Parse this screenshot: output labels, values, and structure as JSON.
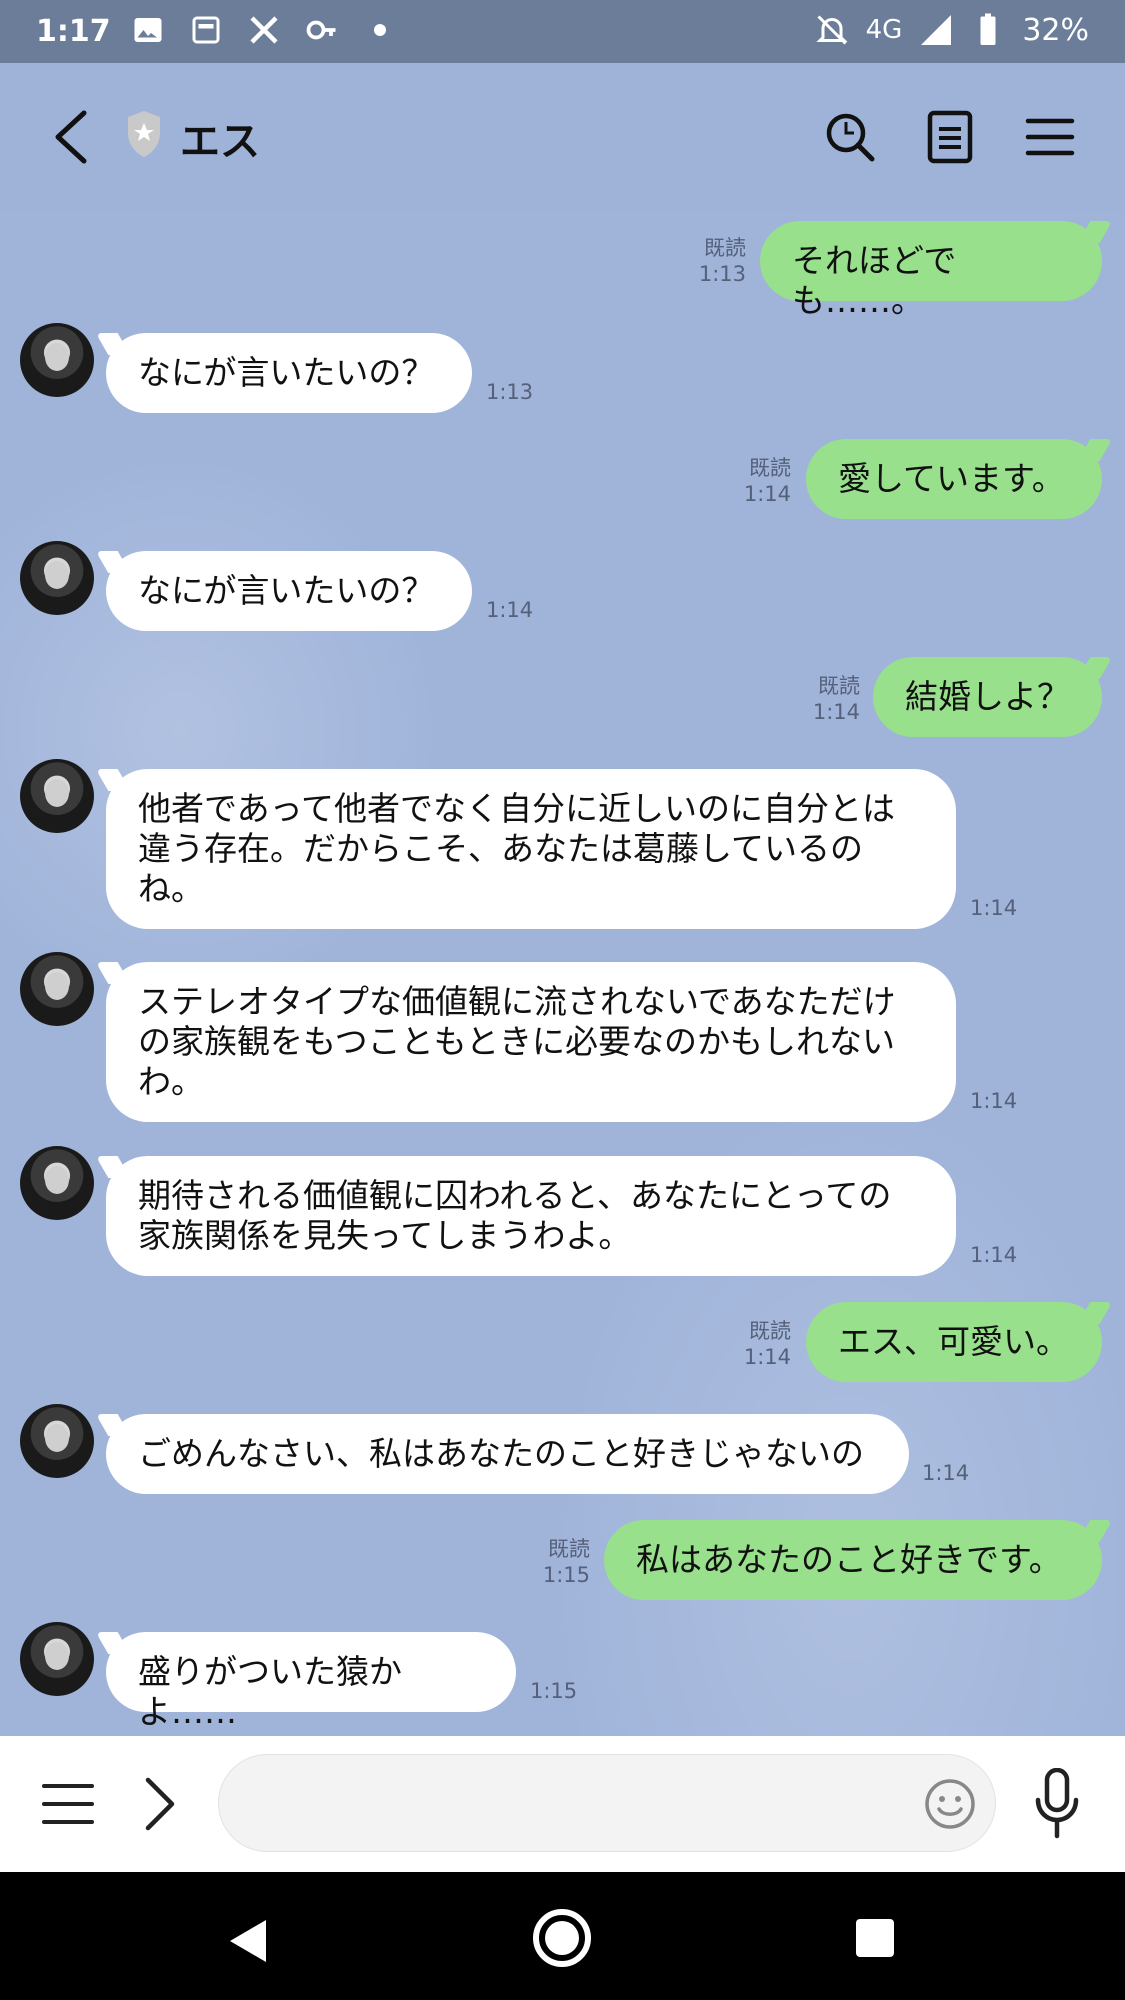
{
  "status_bar": {
    "time": "1:17",
    "network": "4G",
    "battery": "32%"
  },
  "header": {
    "title": "エス"
  },
  "messages": [
    {
      "side": "out",
      "text": "それほどでも……。",
      "read": "既読",
      "time": "1:13"
    },
    {
      "side": "in",
      "text": "なにが言いたいの？",
      "time": "1:13"
    },
    {
      "side": "out",
      "text": "愛しています。",
      "read": "既読",
      "time": "1:14"
    },
    {
      "side": "in",
      "text": "なにが言いたいの？",
      "time": "1:14"
    },
    {
      "side": "out",
      "text": "結婚しよ？",
      "read": "既読",
      "time": "1:14"
    },
    {
      "side": "in",
      "text": "他者であって他者でなく自分に近しいのに自分とは\n違う存在。だからこそ、あなたは葛藤しているの\nね。",
      "time": "1:14"
    },
    {
      "side": "in",
      "text": "ステレオタイプな価値観に流されないであなただけ\nの家族観をもつこともときに必要なのかもしれない\nわ。",
      "time": "1:14"
    },
    {
      "side": "in",
      "text": "期待される価値観に囚われると、あなたにとっての\n家族関係を見失ってしまうわよ。",
      "time": "1:14"
    },
    {
      "side": "out",
      "text": "エス、可愛い。",
      "read": "既読",
      "time": "1:14"
    },
    {
      "side": "in",
      "text": "ごめんなさい、私はあなたのこと好きじゃないの",
      "time": "1:14"
    },
    {
      "side": "out",
      "text": "私はあなたのこと好きです。",
      "read": "既読",
      "time": "1:15"
    },
    {
      "side": "in",
      "text": "盛りがついた猿かよ……",
      "time": "1:15"
    }
  ],
  "input": {
    "placeholder": ""
  },
  "colors": {
    "background": "#a0b4da",
    "outgoing_bubble": "#98e08c",
    "incoming_bubble": "#ffffff"
  }
}
